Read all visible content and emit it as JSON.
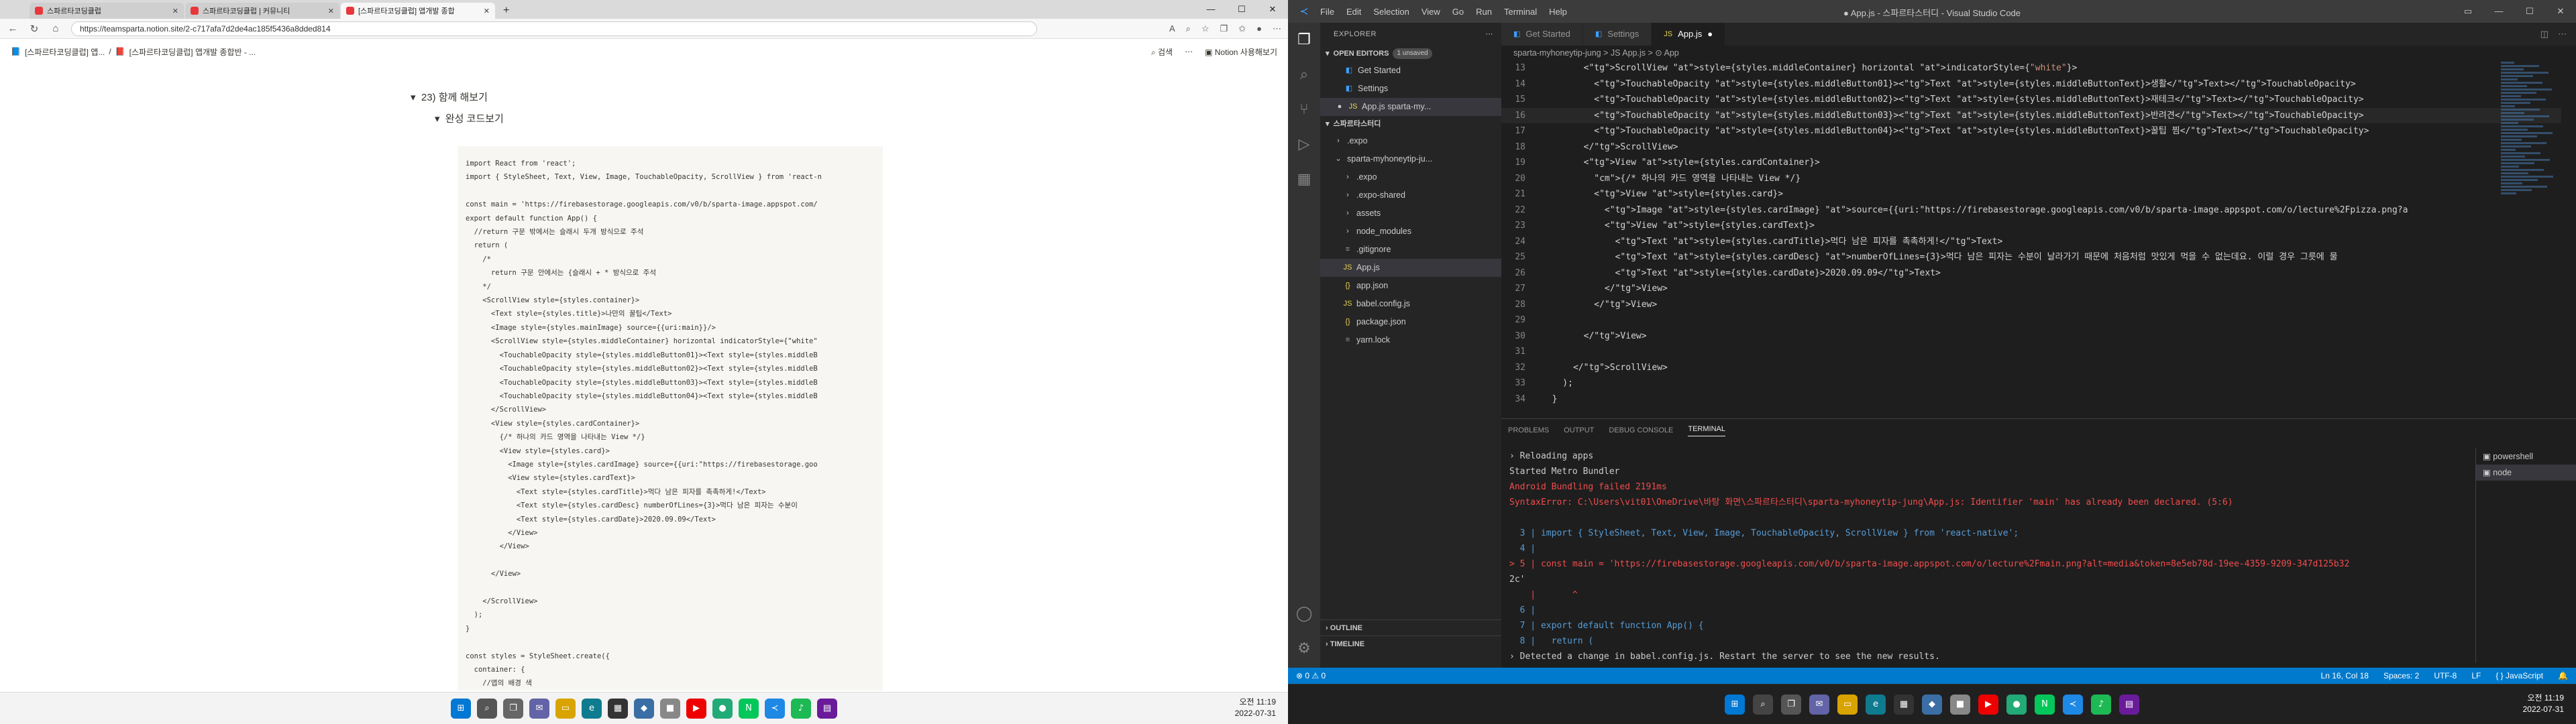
{
  "browser": {
    "tabs": [
      {
        "title": "스파르타코딩클럽",
        "active": false
      },
      {
        "title": "스파르타코딩클럽 | 커뮤니티",
        "active": false
      },
      {
        "title": "[스파르타코딩클럽] 앱개발 종합",
        "active": true
      }
    ],
    "url": "https://teamsparta.notion.site/2-c717afa7d2de4ac185f5436a8dded814",
    "breadcrumb": [
      "[스파르타코딩클럽] 앱...",
      "[스파르타코딩클럽] 앱개발 종합반 - ..."
    ],
    "search_label": "검색",
    "notion_label": "Notion 사용해보기",
    "toggle_section": "23) 함께 해보기",
    "toggle_sub": "완성 코드보기",
    "code_lines": [
      "import React from 'react';",
      "import { StyleSheet, Text, View, Image, TouchableOpacity, ScrollView } from 'react-n",
      "",
      "const main = 'https://firebasestorage.googleapis.com/v0/b/sparta-image.appspot.com/",
      "export default function App() {",
      "  //return 구문 밖에서는 슬래시 두개 방식으로 주석",
      "  return (",
      "    /*",
      "      return 구문 안에서는 {슬래시 + * 방식으로 주석",
      "    */",
      "    <ScrollView style={styles.container}>",
      "      <Text style={styles.title}>나만의 꿀팁</Text>",
      "      <Image style={styles.mainImage} source={{uri:main}}/>",
      "      <ScrollView style={styles.middleContainer} horizontal indicatorStyle={\"white\"",
      "        <TouchableOpacity style={styles.middleButton01}><Text style={styles.middleB",
      "        <TouchableOpacity style={styles.middleButton02}><Text style={styles.middleB",
      "        <TouchableOpacity style={styles.middleButton03}><Text style={styles.middleB",
      "        <TouchableOpacity style={styles.middleButton04}><Text style={styles.middleB",
      "      </ScrollView>",
      "      <View style={styles.cardContainer}>",
      "        {/* 하나의 카드 영역을 나타내는 View */}",
      "        <View style={styles.card}>",
      "          <Image style={styles.cardImage} source={{uri:\"https://firebasestorage.goo",
      "          <View style={styles.cardText}>",
      "            <Text style={styles.cardTitle}>먹다 남은 피자를 촉촉하게!</Text>",
      "            <Text style={styles.cardDesc} numberOfLines={3}>먹다 남은 피자는 수분이",
      "            <Text style={styles.cardDate}>2020.09.09</Text>",
      "          </View>",
      "        </View>",
      "",
      "      </View>",
      "",
      "    </ScrollView>",
      "  );",
      "}",
      "",
      "const styles = StyleSheet.create({",
      "  container: {",
      "    //앱의 배경 색"
    ],
    "clock_time": "오전 11:19",
    "clock_date": "2022-07-31"
  },
  "vscode": {
    "menu": [
      "File",
      "Edit",
      "Selection",
      "View",
      "Go",
      "Run",
      "Terminal",
      "Help"
    ],
    "window_title": "● App.js - 스파르타스터디 - Visual Studio Code",
    "explorer_title": "EXPLORER",
    "open_editors_label": "OPEN EDITORS",
    "unsaved_badge": "1 unsaved",
    "open_editors": [
      "Get Started",
      "Settings",
      "App.js  sparta-my..."
    ],
    "workspace_label": "스파르타스터디",
    "tree": [
      {
        "name": ".expo",
        "depth": 1,
        "type": "folder"
      },
      {
        "name": "sparta-myhoneytip-ju...",
        "depth": 1,
        "type": "folder-open"
      },
      {
        "name": ".expo",
        "depth": 2,
        "type": "folder"
      },
      {
        "name": ".expo-shared",
        "depth": 2,
        "type": "folder"
      },
      {
        "name": "assets",
        "depth": 2,
        "type": "folder"
      },
      {
        "name": "node_modules",
        "depth": 2,
        "type": "folder"
      },
      {
        "name": ".gitignore",
        "depth": 2,
        "type": "file"
      },
      {
        "name": "App.js",
        "depth": 2,
        "type": "js"
      },
      {
        "name": "app.json",
        "depth": 2,
        "type": "json"
      },
      {
        "name": "babel.config.js",
        "depth": 2,
        "type": "js"
      },
      {
        "name": "package.json",
        "depth": 2,
        "type": "json"
      },
      {
        "name": "yarn.lock",
        "depth": 2,
        "type": "file"
      }
    ],
    "outline_label": "OUTLINE",
    "timeline_label": "TIMELINE",
    "editor_tabs": [
      {
        "label": "Get Started",
        "active": false
      },
      {
        "label": "Settings",
        "active": false
      },
      {
        "label": "App.js",
        "active": true
      }
    ],
    "breadcrumb": "sparta-myhoneytip-jung  >  JS App.js  >  ⊙ App",
    "code_lines": [
      {
        "n": "13",
        "text": "        <ScrollView style={styles.middleContainer} horizontal indicatorStyle={\"white\"}>"
      },
      {
        "n": "14",
        "text": "          <TouchableOpacity style={styles.middleButton01}><Text style={styles.middleButtonText}>생활</Text></TouchableOpacity>"
      },
      {
        "n": "15",
        "text": "          <TouchableOpacity style={styles.middleButton02}><Text style={styles.middleButtonText}>재테크</Text></TouchableOpacity>"
      },
      {
        "n": "16",
        "text": "          <TouchableOpacity style={styles.middleButton03}><Text style={styles.middleButtonText}>반려견</Text></TouchableOpacity>"
      },
      {
        "n": "17",
        "text": "          <TouchableOpacity style={styles.middleButton04}><Text style={styles.middleButtonText}>꿀팁 찜</Text></TouchableOpacity>"
      },
      {
        "n": "18",
        "text": "        </ScrollView>"
      },
      {
        "n": "19",
        "text": "        <View style={styles.cardContainer}>"
      },
      {
        "n": "20",
        "text": "          {/* 하나의 카드 영역을 나타내는 View */}"
      },
      {
        "n": "21",
        "text": "          <View style={styles.card}>"
      },
      {
        "n": "22",
        "text": "            <Image style={styles.cardImage} source={{uri:\"https://firebasestorage.googleapis.com/v0/b/sparta-image.appspot.com/o/lecture%2Fpizza.png?a"
      },
      {
        "n": "23",
        "text": "            <View style={styles.cardText}>"
      },
      {
        "n": "24",
        "text": "              <Text style={styles.cardTitle}>먹다 남은 피자를 촉촉하게!</Text>"
      },
      {
        "n": "25",
        "text": "              <Text style={styles.cardDesc} numberOfLines={3}>먹다 남은 피자는 수분이 날라가기 때문에 처음처럼 맛있게 먹을 수 없는데요. 이럴 경우 그릇에 물"
      },
      {
        "n": "26",
        "text": "              <Text style={styles.cardDate}>2020.09.09</Text>"
      },
      {
        "n": "27",
        "text": "            </View>"
      },
      {
        "n": "28",
        "text": "          </View>"
      },
      {
        "n": "29",
        "text": ""
      },
      {
        "n": "30",
        "text": "        </View>"
      },
      {
        "n": "31",
        "text": ""
      },
      {
        "n": "32",
        "text": "      </ScrollView>"
      },
      {
        "n": "33",
        "text": "    );"
      },
      {
        "n": "34",
        "text": "  }"
      }
    ],
    "panel_tabs": [
      "PROBLEMS",
      "OUTPUT",
      "DEBUG CONSOLE",
      "TERMINAL"
    ],
    "terminal_lines": [
      "› Reloading apps",
      "Started Metro Bundler",
      "Android Bundling failed 2191ms",
      "SyntaxError: C:\\Users\\vit01\\OneDrive\\바탕 화면\\스파르타스터디\\sparta-myhoneytip-jung\\App.js: Identifier 'main' has already been declared. (5:6)",
      "",
      "  3 | import { StyleSheet, Text, View, Image, TouchableOpacity, ScrollView } from 'react-native';",
      "  4 |",
      "> 5 | const main = 'https://firebasestorage.googleapis.com/v0/b/sparta-image.appspot.com/o/lecture%2Fmain.png?alt=media&token=8e5eb78d-19ee-4359-9209-347d125b32",
      "2c'",
      "    |       ^",
      "  6 |",
      "  7 | export default function App() {",
      "  8 |   return (",
      "› Detected a change in babel.config.js. Restart the server to see the new results."
    ],
    "terminal_list": [
      "powershell",
      "node"
    ],
    "status": {
      "errors": "⊗ 0  ⚠ 0",
      "position": "Ln 16, Col 18",
      "spaces": "Spaces: 2",
      "encoding": "UTF-8",
      "eol": "LF",
      "language": "{ } JavaScript"
    },
    "clock_time": "오전 11:19",
    "clock_date": "2022-07-31"
  },
  "colors": {
    "vscode_blue": "#007acc",
    "notion_code_bg": "#f7f6f3",
    "error_red": "#f14c4c"
  }
}
